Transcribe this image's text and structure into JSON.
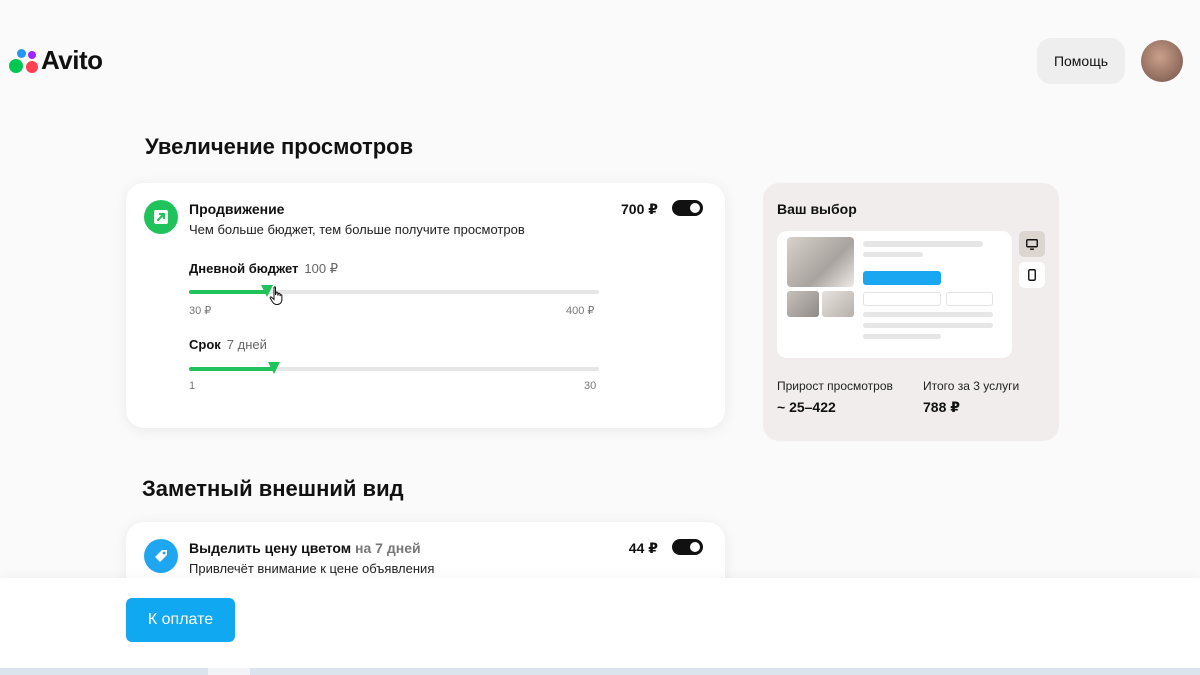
{
  "header": {
    "logo_text": "Avito",
    "help_label": "Помощь",
    "colors": {
      "logo_green": "#00c853",
      "logo_blue": "#2196f3",
      "logo_red": "#ff4053",
      "logo_purple": "#9c27ff"
    }
  },
  "sections": {
    "views_title": "Увеличение просмотров",
    "look_title": "Заметный внешний вид"
  },
  "promotion": {
    "icon": "arrow-up-right-icon",
    "title": "Продвижение",
    "description": "Чем больше бюджет, тем больше получите просмотров",
    "price": "700 ₽",
    "enabled": true,
    "budget": {
      "label": "Дневной бюджет",
      "value": "100 ₽",
      "min_label": "30 ₽",
      "max_label": "400 ₽",
      "min": 30,
      "max": 400,
      "current": 100
    },
    "duration": {
      "label": "Срок",
      "value": "7 дней",
      "min_label": "1",
      "max_label": "30",
      "min": 1,
      "max": 30,
      "current": 7
    }
  },
  "highlight": {
    "icon": "tag-icon",
    "title": "Выделить цену цветом",
    "title_suffix": "на 7 дней",
    "description": "Привлечёт внимание к цене объявления",
    "price": "44 ₽",
    "enabled": true
  },
  "choice": {
    "title": "Ваш выбор",
    "devices": [
      "desktop-icon",
      "mobile-icon"
    ],
    "views_label": "Прирост просмотров",
    "views_value": "~ 25–422",
    "total_label": "Итого за 3 услуги",
    "total_value": "788 ₽"
  },
  "footer": {
    "pay_label": "К оплате",
    "accent": "#10a8f1"
  }
}
